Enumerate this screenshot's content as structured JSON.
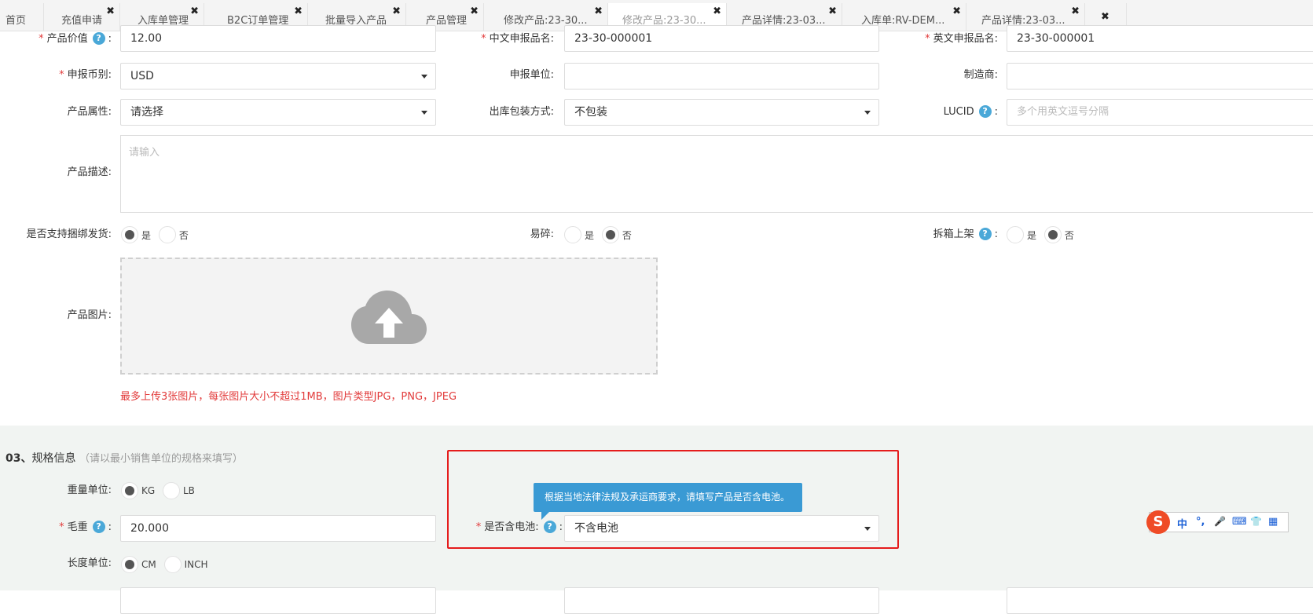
{
  "tabs": [
    {
      "label": "首页",
      "closable": false,
      "active": false
    },
    {
      "label": "充值申请",
      "closable": true,
      "active": false
    },
    {
      "label": "入库单管理",
      "closable": true,
      "active": false
    },
    {
      "label": "B2C订单管理",
      "closable": true,
      "active": false
    },
    {
      "label": "批量导入产品",
      "closable": true,
      "active": false
    },
    {
      "label": "产品管理",
      "closable": true,
      "active": false
    },
    {
      "label": "修改产品:23-30...",
      "closable": true,
      "active": false
    },
    {
      "label": "修改产品:23-30...",
      "closable": true,
      "active": true
    },
    {
      "label": "产品详情:23-03...",
      "closable": true,
      "active": false
    },
    {
      "label": "入库单:RV-DEM...",
      "closable": true,
      "active": false
    },
    {
      "label": "产品详情:23-03...",
      "closable": true,
      "active": false
    }
  ],
  "close_all_label": "✖",
  "tab_close_label": "✖",
  "form": {
    "product_value": {
      "label": "产品价值",
      "value": "12.00",
      "required": true
    },
    "cn_name": {
      "label": "中文申报品名:",
      "value": "23-30-000001",
      "required": true
    },
    "en_name": {
      "label": "英文申报品名:",
      "value": "23-30-000001",
      "required": true
    },
    "currency": {
      "label": "申报币别:",
      "value": "USD",
      "required": true
    },
    "declare_unit": {
      "label": "申报单位:",
      "value": ""
    },
    "manufacturer": {
      "label": "制造商:",
      "value": ""
    },
    "attribute": {
      "label": "产品属性:",
      "value": "请选择"
    },
    "packing": {
      "label": "出库包装方式:",
      "value": "不包装"
    },
    "lucid": {
      "label": "LUCID",
      "placeholder": "多个用英文逗号分隔"
    },
    "description": {
      "label": "产品描述:",
      "placeholder": "请输入"
    },
    "bundle": {
      "label": "是否支持捆绑发货:",
      "yes": "是",
      "no": "否",
      "selected": "yes"
    },
    "fragile": {
      "label": "易碎:",
      "yes": "是",
      "no": "否",
      "selected": "no"
    },
    "split": {
      "label": "拆箱上架",
      "yes": "是",
      "no": "否",
      "selected": "no"
    },
    "image": {
      "label": "产品图片:",
      "hint": "最多上传3张图片，每张图片大小不超过1MB，图片类型JPG，PNG，JPEG"
    }
  },
  "spec": {
    "title_num": "03、",
    "title": "规格信息",
    "subtitle": "（请以最小销售单位的规格来填写）",
    "weight_unit": {
      "label": "重量单位:",
      "opt1": "KG",
      "opt2": "LB",
      "selected": "KG"
    },
    "gross_weight": {
      "label": "毛重",
      "value": "20.000",
      "required": true
    },
    "battery": {
      "label": "是否含电池:",
      "value": "不含电池",
      "required": true
    },
    "battery_tooltip": "根据当地法律法规及承运商要求，请填写产品是否含电池。",
    "length_unit": {
      "label": "长度单位:",
      "opt1": "CM",
      "opt2": "INCH",
      "selected": "CM"
    }
  },
  "help_glyph": "?",
  "colon": ":",
  "ime": {
    "logo": "S",
    "items": [
      "中",
      "°,",
      "🎤",
      "⌨",
      "👕",
      "▦"
    ]
  }
}
